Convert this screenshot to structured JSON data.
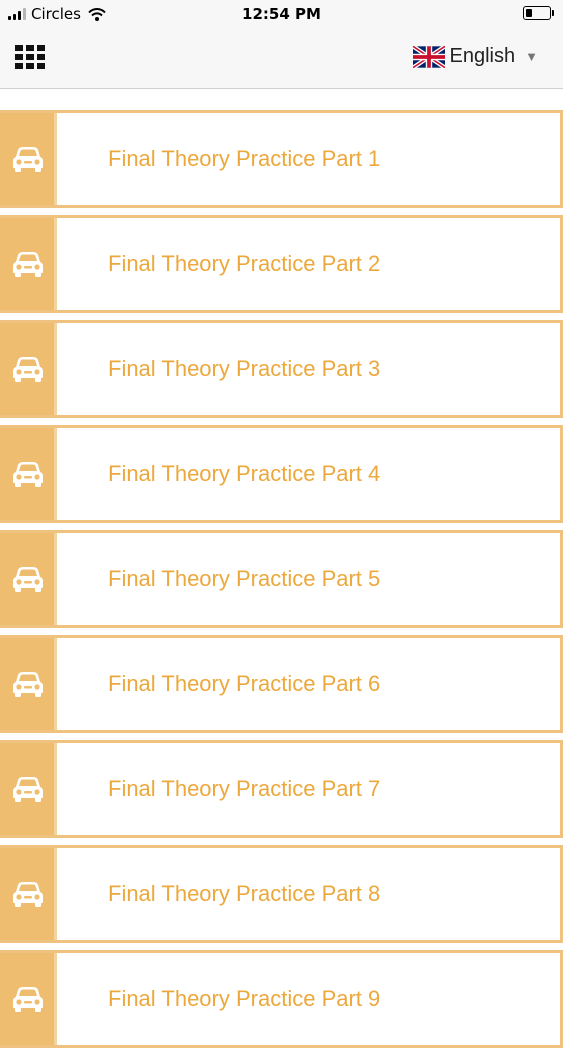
{
  "status_bar": {
    "carrier": "Circles",
    "time": "12:54 PM",
    "battery_level": 0.25
  },
  "header": {
    "menu_icon": "grid-icon",
    "language": {
      "flag_icon": "uk-flag-icon",
      "label": "English",
      "dropdown_icon": "caret-down-icon"
    }
  },
  "colors": {
    "accent": "#eca83c",
    "side_strip": "#eebd6f",
    "border": "#f0c27f"
  },
  "practice_list": {
    "item_icon": "car-icon",
    "items": [
      {
        "label": "Final Theory Practice Part 1"
      },
      {
        "label": "Final Theory Practice Part 2"
      },
      {
        "label": "Final Theory Practice Part 3"
      },
      {
        "label": "Final Theory Practice Part 4"
      },
      {
        "label": "Final Theory Practice Part 5"
      },
      {
        "label": "Final Theory Practice Part 6"
      },
      {
        "label": "Final Theory Practice Part 7"
      },
      {
        "label": "Final Theory Practice Part 8"
      },
      {
        "label": "Final Theory Practice Part 9"
      }
    ]
  }
}
